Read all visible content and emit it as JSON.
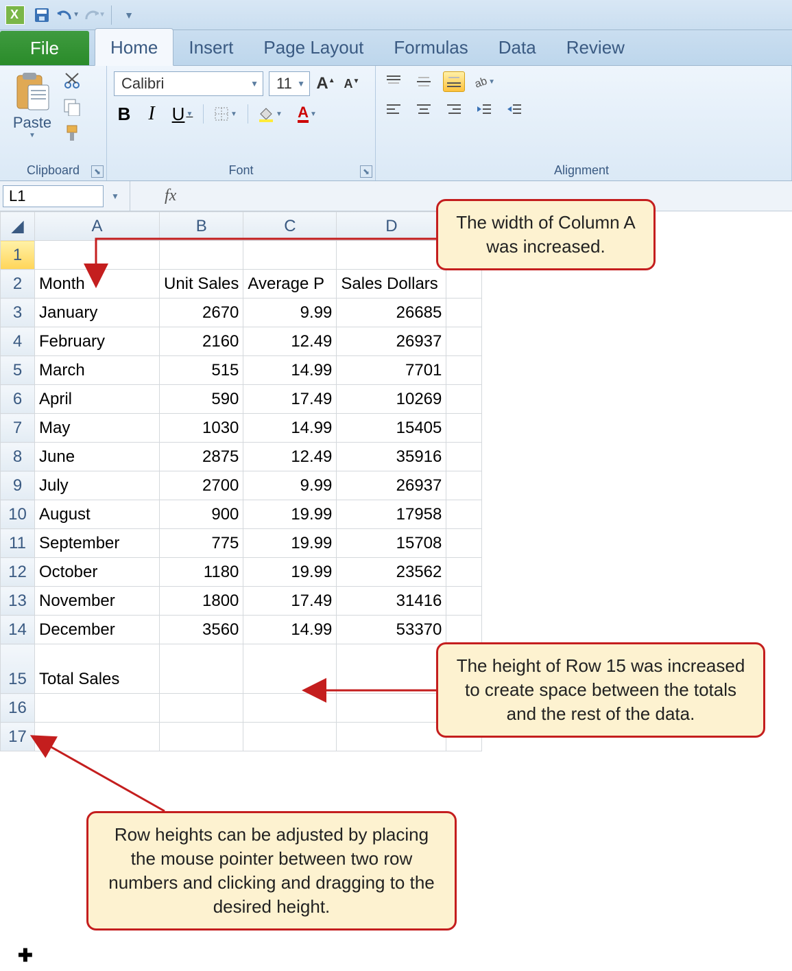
{
  "qat": {
    "save_tip": "Save",
    "undo_tip": "Undo",
    "redo_tip": "Redo",
    "customize_tip": "Customize"
  },
  "tabs": {
    "file": "File",
    "home": "Home",
    "insert": "Insert",
    "page_layout": "Page Layout",
    "formulas": "Formulas",
    "data": "Data",
    "review": "Review"
  },
  "ribbon": {
    "clipboard": {
      "label": "Clipboard",
      "paste": "Paste"
    },
    "font": {
      "label": "Font",
      "font_name": "Calibri",
      "font_size": "11",
      "bold": "B",
      "italic": "I",
      "underline": "U"
    },
    "alignment": {
      "label": "Alignment"
    }
  },
  "name_box": "L1",
  "fx_label": "fx",
  "columns": [
    "A",
    "B",
    "C",
    "D"
  ],
  "rows": {
    "headers": {
      "A": "Month",
      "B": "Unit Sales",
      "C": "Average P",
      "D": "Sales Dollars"
    },
    "data": [
      {
        "num": 3,
        "A": "January",
        "B": 2670,
        "C": 9.99,
        "D": 26685
      },
      {
        "num": 4,
        "A": "February",
        "B": 2160,
        "C": 12.49,
        "D": 26937
      },
      {
        "num": 5,
        "A": "March",
        "B": 515,
        "C": 14.99,
        "D": 7701
      },
      {
        "num": 6,
        "A": "April",
        "B": 590,
        "C": 17.49,
        "D": 10269
      },
      {
        "num": 7,
        "A": "May",
        "B": 1030,
        "C": 14.99,
        "D": 15405
      },
      {
        "num": 8,
        "A": "June",
        "B": 2875,
        "C": 12.49,
        "D": 35916
      },
      {
        "num": 9,
        "A": "July",
        "B": 2700,
        "C": 9.99,
        "D": 26937
      },
      {
        "num": 10,
        "A": "August",
        "B": 900,
        "C": 19.99,
        "D": 17958
      },
      {
        "num": 11,
        "A": "September",
        "B": 775,
        "C": 19.99,
        "D": 15708
      },
      {
        "num": 12,
        "A": "October",
        "B": 1180,
        "C": 19.99,
        "D": 23562
      },
      {
        "num": 13,
        "A": "November",
        "B": 1800,
        "C": 17.49,
        "D": 31416
      },
      {
        "num": 14,
        "A": "December",
        "B": 3560,
        "C": 14.99,
        "D": 53370
      }
    ],
    "total_label": "Total Sales"
  },
  "row_numbers": {
    "r1": "1",
    "r2": "2",
    "r15": "15",
    "r16": "16",
    "r17": "17"
  },
  "callouts": {
    "c1": "The width of Column A was increased.",
    "c2": "The height of Row 15 was increased to create space between the totals and the rest of the data.",
    "c3": "Row heights can be adjusted by placing the mouse pointer between two row numbers and clicking and dragging to the desired height."
  }
}
